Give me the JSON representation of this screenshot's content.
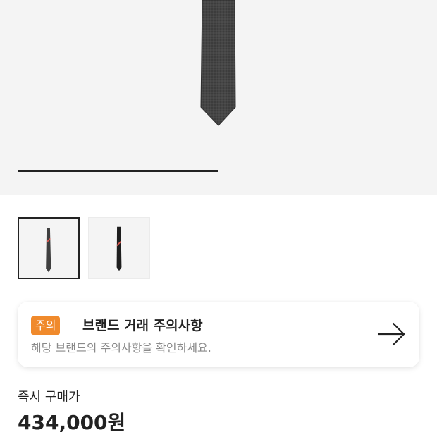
{
  "gallery": {
    "progress_fraction": 0.5,
    "thumbnails": [
      {
        "alt": "tie-front-image",
        "selected": true
      },
      {
        "alt": "tie-back-image",
        "selected": false
      }
    ]
  },
  "notice": {
    "badge": "주의",
    "title": "브랜드 거래 주의사항",
    "description": "해당 브랜드의 주의사항을 확인하세요.",
    "icon": "arrow-right-icon",
    "badge_color": "#f08a2c"
  },
  "price": {
    "label": "즉시 구매가",
    "value": "434,000원"
  },
  "colors": {
    "hero_background": "#f4f4f4",
    "text_primary": "#222222",
    "text_secondary": "#8a8a8a"
  }
}
